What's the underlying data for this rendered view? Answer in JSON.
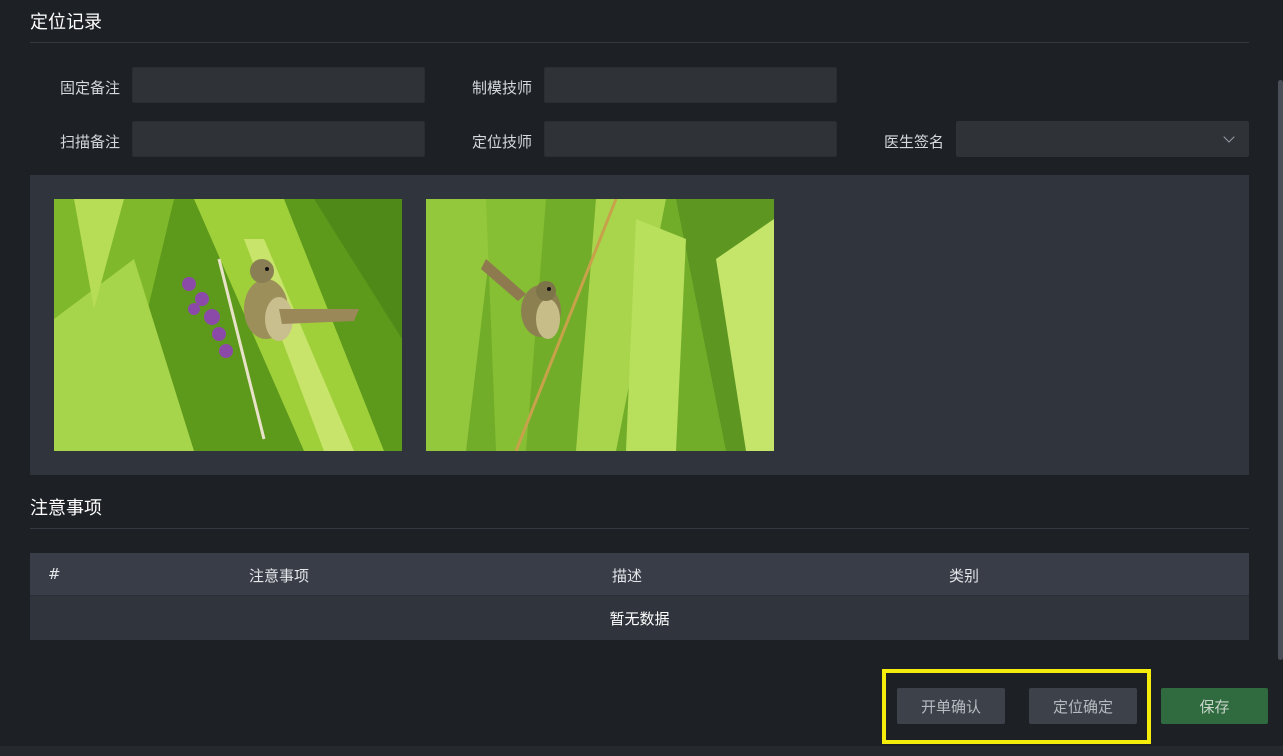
{
  "positioning_record": {
    "title": "定位记录",
    "fields": {
      "fixed_note": {
        "label": "固定备注",
        "value": ""
      },
      "mold_technician": {
        "label": "制模技师",
        "value": ""
      },
      "scan_note": {
        "label": "扫描备注",
        "value": ""
      },
      "positioning_technician": {
        "label": "定位技师",
        "value": ""
      },
      "doctor_signature": {
        "label": "医生签名",
        "value": ""
      }
    }
  },
  "notes": {
    "title": "注意事项",
    "table": {
      "columns": [
        "#",
        "注意事项",
        "描述",
        "类别"
      ],
      "rows": [],
      "empty_text": "暂无数据"
    }
  },
  "actions": {
    "open_confirm": "开单确认",
    "position_confirm": "定位确定",
    "save": "保存"
  },
  "colors": {
    "highlight": "#f4ec0b",
    "save_button": "#2f6b3e"
  }
}
